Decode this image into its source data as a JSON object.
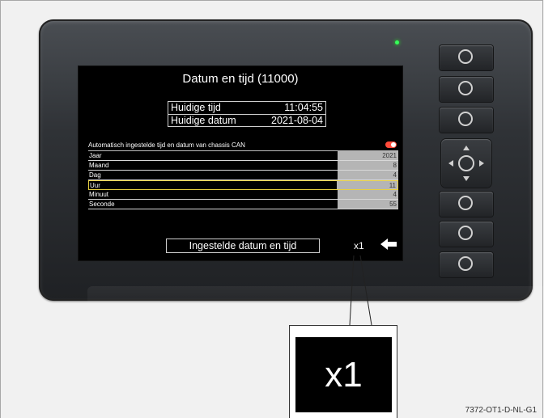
{
  "screen": {
    "title": "Datum en tijd (11000)",
    "current_time_label": "Huidige tijd",
    "current_time_value": "11:04:55",
    "current_date_label": "Huidige datum",
    "current_date_value": "2021-08-04",
    "auto_label": "Automatisch ingestelde tijd en datum van chassis CAN",
    "auto_enabled": true,
    "rows": [
      {
        "label": "Jaar",
        "value": "2021"
      },
      {
        "label": "Maand",
        "value": "8"
      },
      {
        "label": "Dag",
        "value": "4"
      },
      {
        "label": "Uur",
        "value": "11"
      },
      {
        "label": "Minuut",
        "value": "4"
      },
      {
        "label": "Seconde",
        "value": "55"
      }
    ],
    "selected_row": "Uur",
    "confirm_label": "Ingestelde datum en tijd",
    "step_label": "x1",
    "back_icon": "back-arrow-icon"
  },
  "callout": {
    "label": "x1"
  },
  "figure_code": "7372-OT1-D-NL-G1",
  "colors": {
    "selection": "#e8d040",
    "toggle_on": "#ff4a3a",
    "led": "#35ff5a"
  }
}
